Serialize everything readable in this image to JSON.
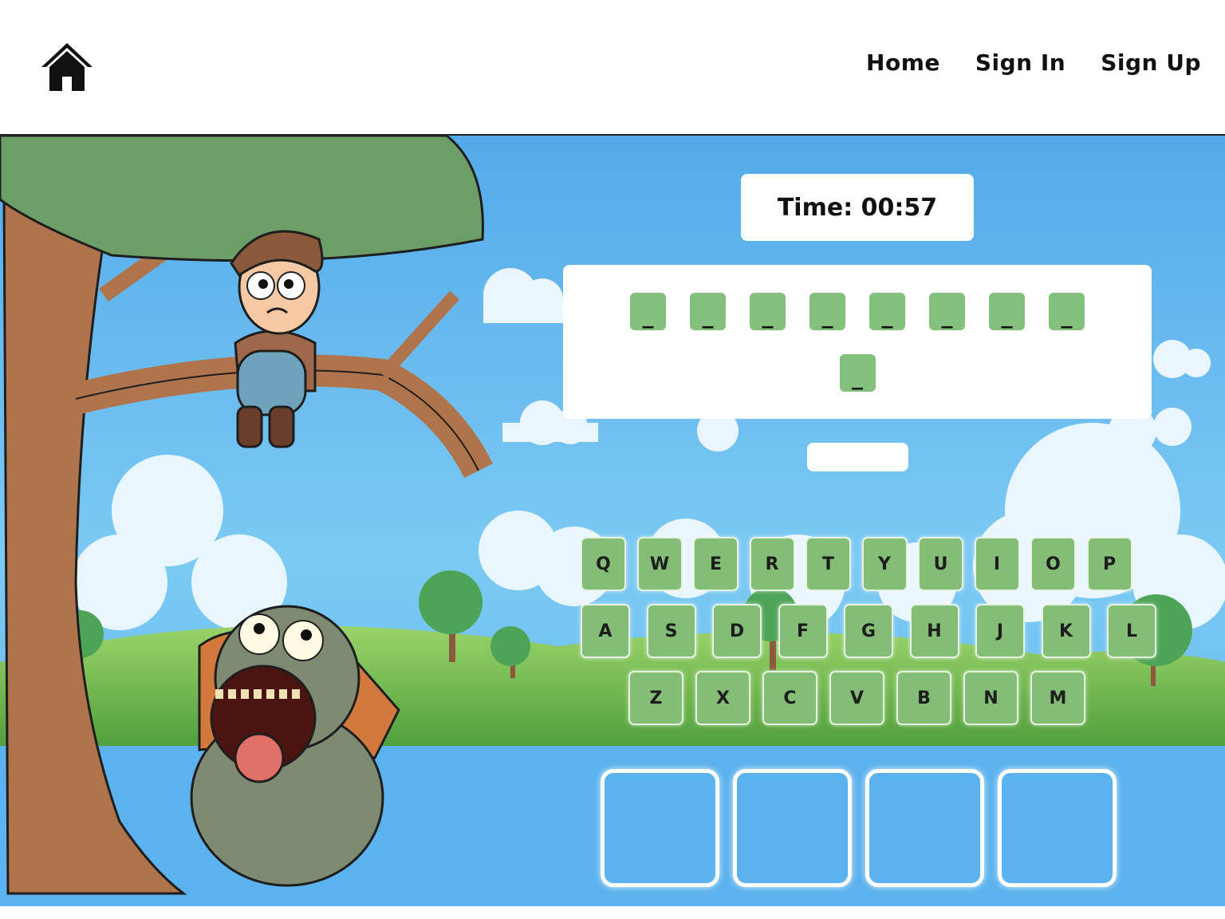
{
  "header": {
    "home_icon": "house-icon",
    "nav": {
      "home": "Home",
      "sign_in": "Sign In",
      "sign_up": "Sign Up"
    }
  },
  "game": {
    "timer_text": "Time: 00:57",
    "word_slots": [
      "_",
      "_",
      "_",
      "_",
      "_",
      "_",
      "_",
      "_",
      "_"
    ],
    "status_text": "",
    "keyboard": {
      "row1": [
        "Q",
        "W",
        "E",
        "R",
        "T",
        "Y",
        "U",
        "I",
        "O",
        "P"
      ],
      "row2": [
        "A",
        "S",
        "D",
        "F",
        "G",
        "H",
        "J",
        "K",
        "L"
      ],
      "row3": [
        "Z",
        "X",
        "C",
        "V",
        "B",
        "N",
        "M"
      ]
    },
    "lives_total": 4,
    "colors": {
      "key": "#84bd76",
      "slot": "#82c07c",
      "sky": "#5cb2ee"
    }
  }
}
